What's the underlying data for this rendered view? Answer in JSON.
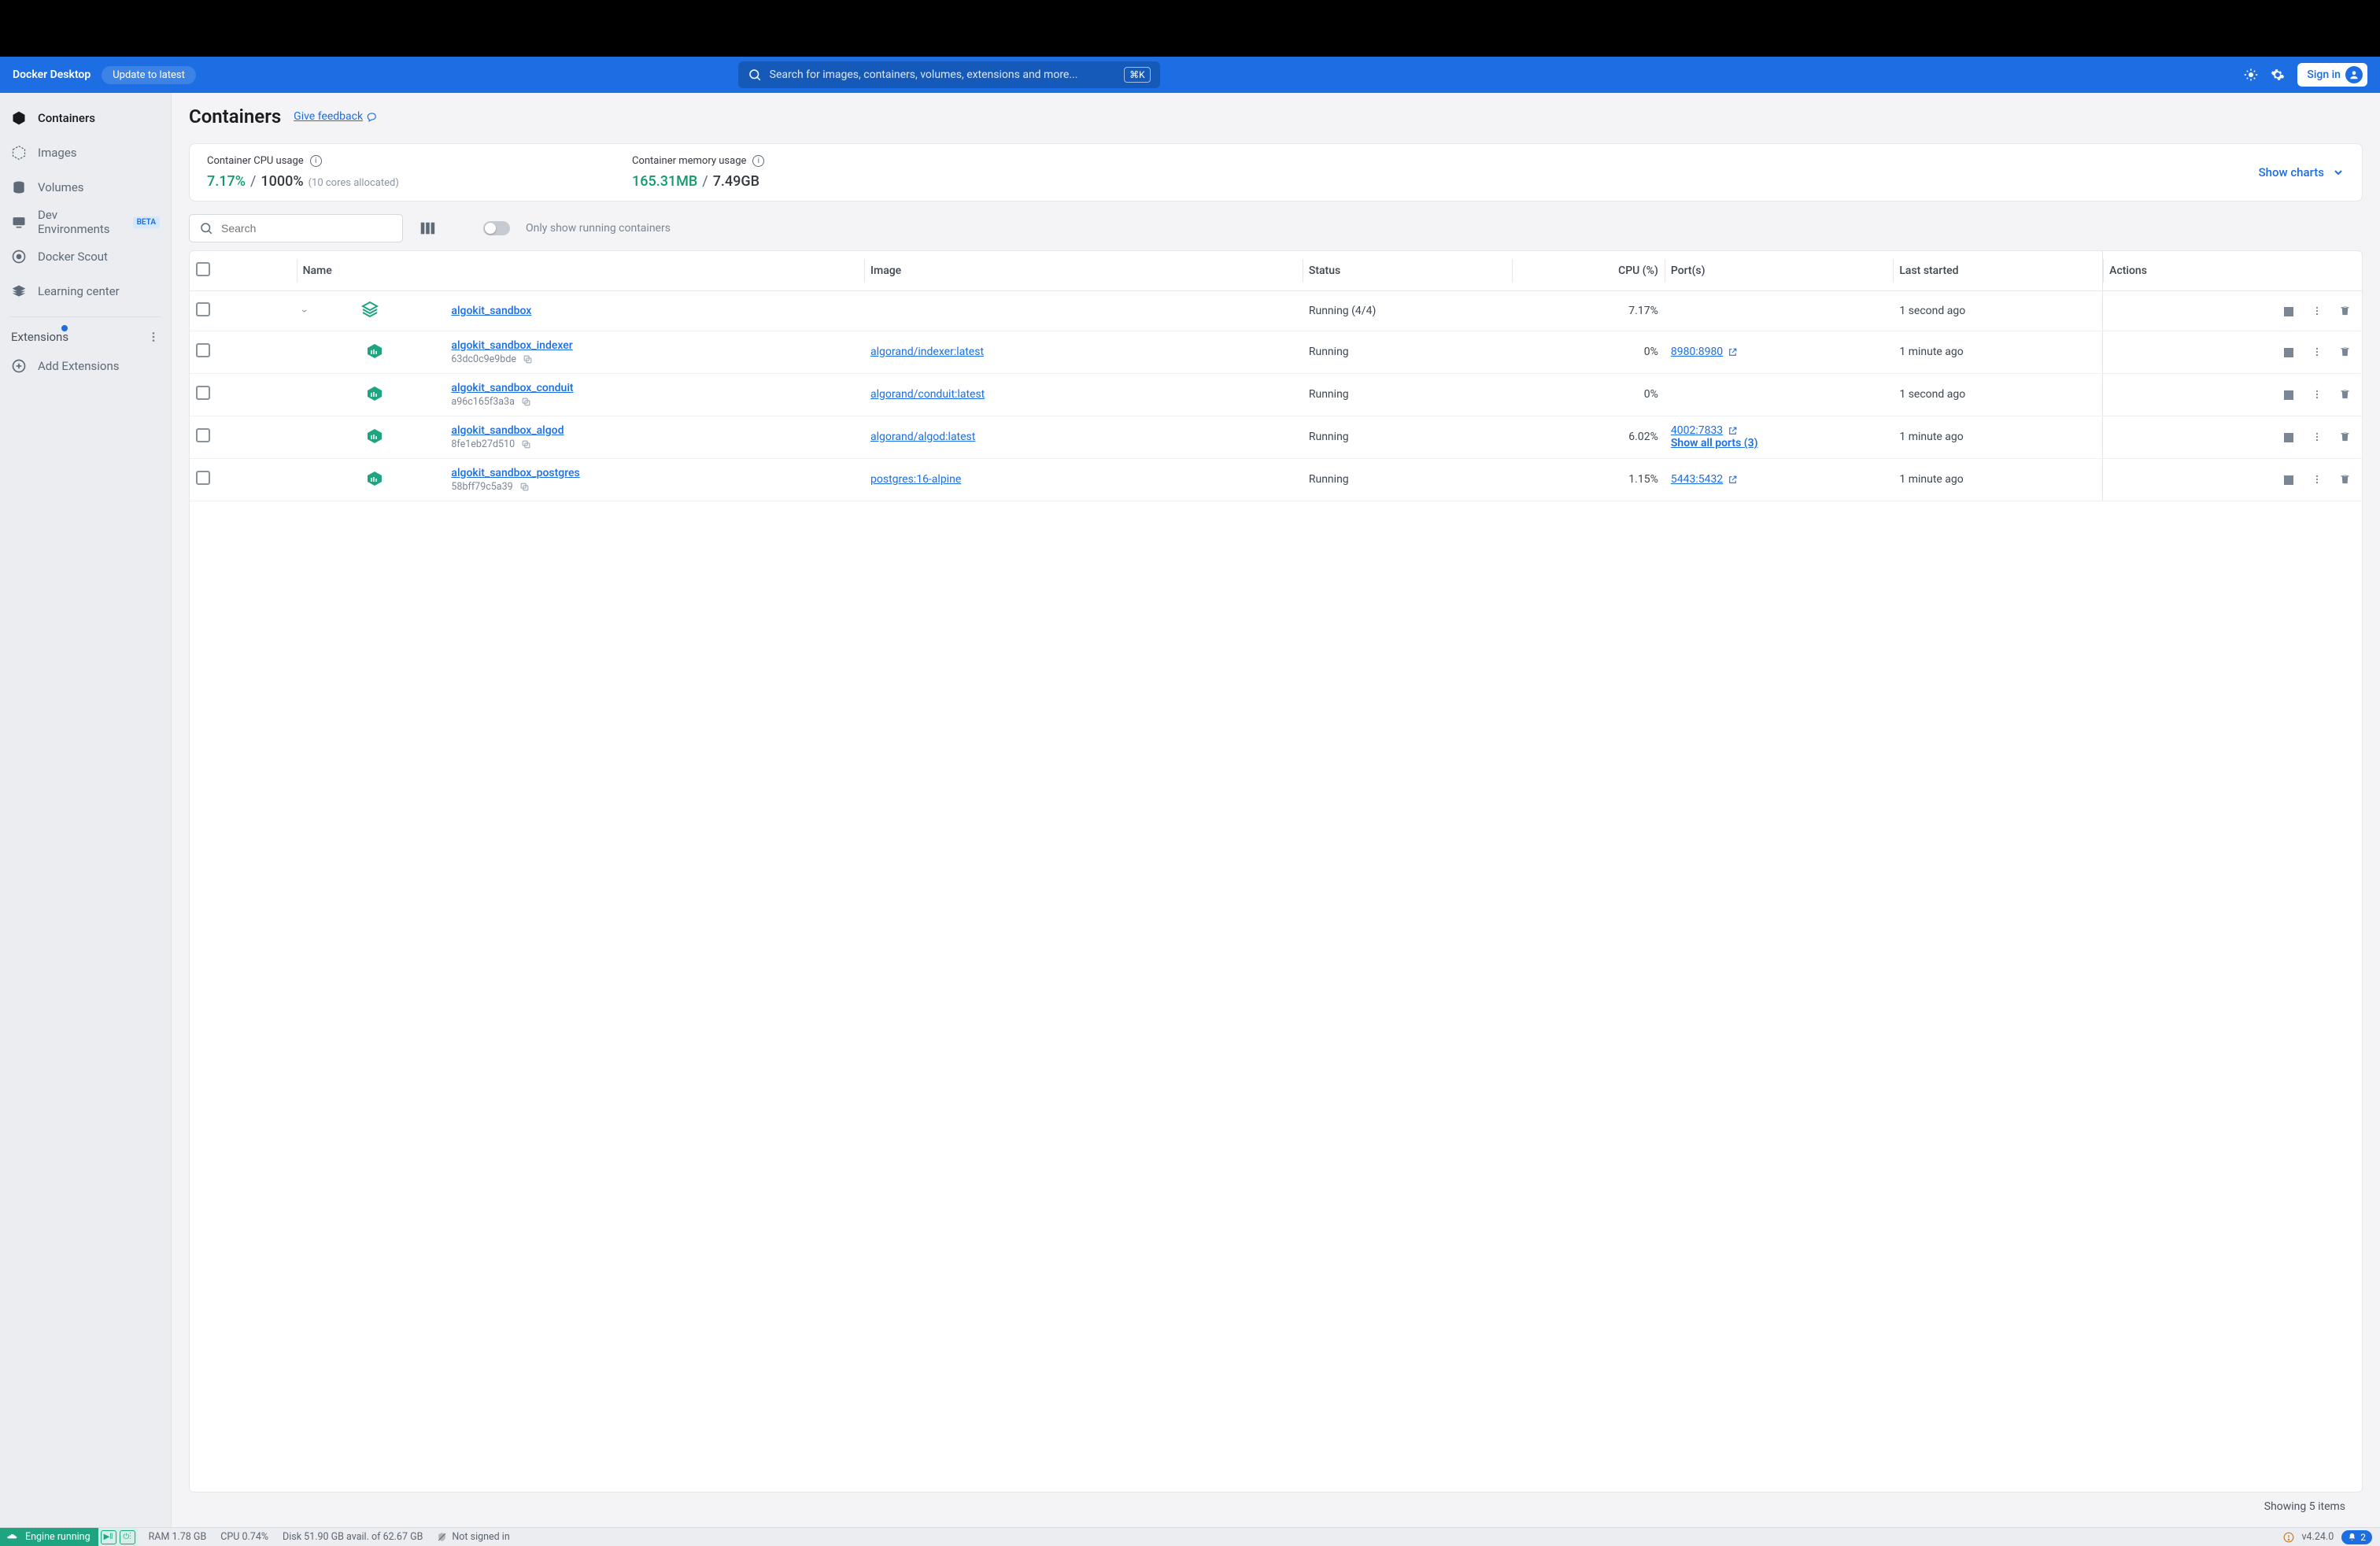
{
  "header": {
    "brand": "Docker Desktop",
    "update": "Update to latest",
    "search_placeholder": "Search for images, containers, volumes, extensions and more...",
    "shortcut": "⌘K",
    "sign_in": "Sign in"
  },
  "sidebar": {
    "items": [
      {
        "label": "Containers",
        "active": true
      },
      {
        "label": "Images"
      },
      {
        "label": "Volumes"
      },
      {
        "label": "Dev Environments",
        "badge": "BETA"
      },
      {
        "label": "Docker Scout"
      },
      {
        "label": "Learning center"
      }
    ],
    "extensions_label": "Extensions",
    "add_extensions": "Add Extensions"
  },
  "page": {
    "title": "Containers",
    "feedback": "Give feedback"
  },
  "stats": {
    "cpu_label": "Container CPU usage",
    "cpu_used": "7.17%",
    "cpu_total": "1000%",
    "cpu_detail": "(10 cores allocated)",
    "mem_label": "Container memory usage",
    "mem_used": "165.31MB",
    "mem_total": "7.49GB",
    "show_charts": "Show charts"
  },
  "controls": {
    "search_placeholder": "Search",
    "toggle_label": "Only show running containers"
  },
  "table": {
    "headers": {
      "name": "Name",
      "image": "Image",
      "status": "Status",
      "cpu": "CPU (%)",
      "ports": "Port(s)",
      "last": "Last started",
      "actions": "Actions"
    },
    "parent": {
      "name": "algokit_sandbox",
      "status": "Running (4/4)",
      "cpu": "7.17%",
      "last": "1 second ago"
    },
    "rows": [
      {
        "name": "algokit_sandbox_indexer",
        "id": "63dc0c9e9bde",
        "image": "algorand/indexer:latest",
        "status": "Running",
        "cpu": "0%",
        "port": "8980:8980",
        "last": "1 minute ago"
      },
      {
        "name": "algokit_sandbox_conduit",
        "id": "a96c165f3a3a",
        "image": "algorand/conduit:latest",
        "status": "Running",
        "cpu": "0%",
        "port": "",
        "last": "1 second ago"
      },
      {
        "name": "algokit_sandbox_algod",
        "id": "8fe1eb27d510",
        "image": "algorand/algod:latest",
        "status": "Running",
        "cpu": "6.02%",
        "port": "4002:7833",
        "show_all": "Show all ports (3)",
        "last": "1 minute ago"
      },
      {
        "name": "algokit_sandbox_postgres",
        "id": "58bff79c5a39",
        "image": "postgres:16-alpine",
        "status": "Running",
        "cpu": "1.15%",
        "port": "5443:5432",
        "last": "1 minute ago"
      }
    ],
    "showing": "Showing 5 items"
  },
  "footer": {
    "engine": "Engine running",
    "ram": "RAM 1.78 GB",
    "cpu": "CPU 0.74%",
    "disk": "Disk 51.90 GB avail. of 62.67 GB",
    "signed": "Not signed in",
    "version": "v4.24.0",
    "notif": "2"
  }
}
